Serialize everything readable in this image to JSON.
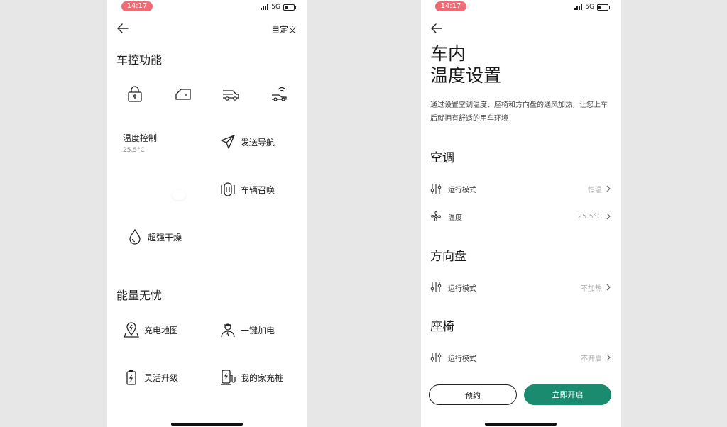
{
  "status_bar": {
    "time": "14:17",
    "network": "5G"
  },
  "left_screen": {
    "customize_label": "自定义",
    "section_car_control": "车控功能",
    "control_icons": [
      "lock-icon",
      "car-door-icon",
      "car-trunk-icon",
      "car-horn-icon"
    ],
    "temperature": {
      "title": "温度控制",
      "value": "25.5°C"
    },
    "features": {
      "send_navigation": "发送导航",
      "vehicle_summon": "车辆召唤",
      "super_dry": "超强干燥"
    },
    "section_energy": "能量无忧",
    "energy_features": {
      "charging_map": "充电地图",
      "one_key_charge": "一键加电",
      "flexible_upgrade": "灵活升级",
      "home_charger": "我的家充桩"
    }
  },
  "right_screen": {
    "title_line1": "车内",
    "title_line2": "温度设置",
    "description": "通过设置空调温度、座椅和方向盘的通风加热，让您上车后就拥有舒适的用车环境",
    "ac": {
      "title": "空调",
      "mode_label": "运行模式",
      "mode_value": "恒温",
      "temp_label": "温度",
      "temp_value": "25.5°C"
    },
    "steering": {
      "title": "方向盘",
      "mode_label": "运行模式",
      "mode_value": "不加热"
    },
    "seat": {
      "title": "座椅",
      "mode_label": "运行模式",
      "mode_value": "不开启"
    },
    "buttons": {
      "schedule": "预约",
      "start_now": "立即开启"
    },
    "accent_color": "#1a8b6e"
  }
}
